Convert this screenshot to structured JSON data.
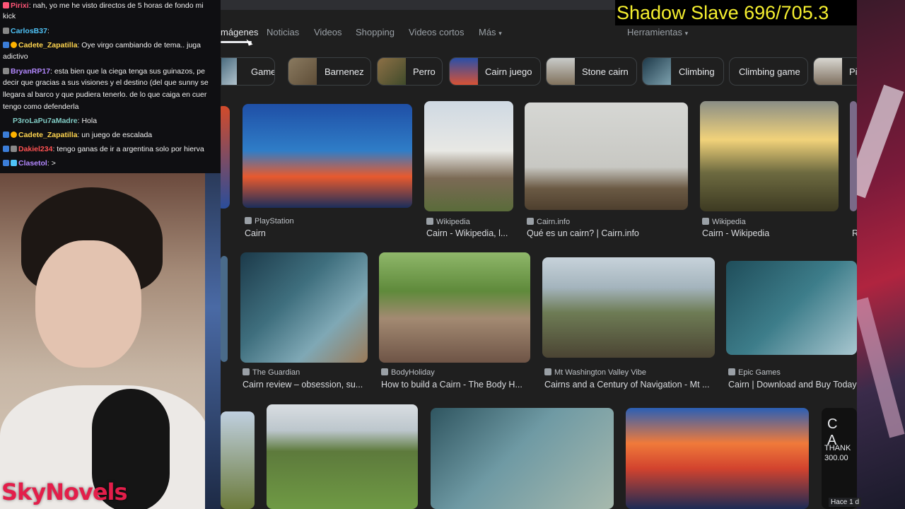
{
  "overlay": {
    "title": "Shadow Slave 696/705.3"
  },
  "tabs": [
    {
      "label": "mágenes",
      "active": true
    },
    {
      "label": "Noticias"
    },
    {
      "label": "Videos"
    },
    {
      "label": "Shopping"
    },
    {
      "label": "Videos cortos"
    },
    {
      "label": "Más"
    }
  ],
  "tools": {
    "label": "Herramientas"
  },
  "chips": [
    "Game",
    "Barnenez",
    "Perro",
    "Cairn juego",
    "Stone cairn",
    "Climbing",
    "Climbing game",
    "Pi"
  ],
  "results": {
    "row1": [
      {
        "source": "PlayStation",
        "title": "Cairn"
      },
      {
        "source": "Wikipedia",
        "title": "Cairn - Wikipedia, l..."
      },
      {
        "source": "Cairn.info",
        "title": "Qué es un cairn? | Cairn.info"
      },
      {
        "source": "Wikipedia",
        "title": "Cairn - Wikipedia"
      },
      {
        "source": "",
        "title": "R"
      }
    ],
    "row2": [
      {
        "source": "The Guardian",
        "title": "Cairn review – obsession, su..."
      },
      {
        "source": "BodyHoliday",
        "title": "How to build a Cairn - The Body H..."
      },
      {
        "source": "Mt Washington Valley Vibe",
        "title": "Cairns and a Century of Navigation - Mt ..."
      },
      {
        "source": "Epic Games",
        "title": "Cairn | Download and Buy Today"
      }
    ],
    "row3_partial_text": "C A",
    "row3_partial_small": "THANK\n300.00"
  },
  "bottom_badge": "Hace 1 d",
  "chat": [
    {
      "user": "Pirixi",
      "user_color": "#ff5577",
      "text": ": nah, yo me he visto directos de 5 horas de fondo mi"
    },
    {
      "user": "",
      "user_color": "#ffffff",
      "text": "kick"
    },
    {
      "user": "CarlosB37",
      "user_color": "#4fc3f7",
      "text": ": "
    },
    {
      "user": "Cadete_Zapatilla",
      "user_color": "#ffd54f",
      "text": ": Oye virgo cambiando de tema.. juga"
    },
    {
      "user": "",
      "user_color": "#ffffff",
      "text": "adictivo"
    },
    {
      "user": "BryanRP17",
      "user_color": "#b388ff",
      "text": ": esta bien que la ciega tenga sus guinazos, pe"
    },
    {
      "user": "",
      "user_color": "#ffffff",
      "text": "decir que gracias a sus visiones y el destino (del que sunny se"
    },
    {
      "user": "",
      "user_color": "#ffffff",
      "text": "llegara al barco y que pudiera tenerlo. de lo que caiga en cuer"
    },
    {
      "user": "",
      "user_color": "#ffffff",
      "text": "tengo como defenderla"
    },
    {
      "user": "P3roLaPu7aMadre",
      "user_color": "#80cbc4",
      "text": ": Hola"
    },
    {
      "user": "Cadete_Zapatilla",
      "user_color": "#ffd54f",
      "text": ": un juego de escalada"
    },
    {
      "user": "Dakiel234",
      "user_color": "#ff5252",
      "text": ": tengo ganas de ir a argentina solo por hierva"
    },
    {
      "user": "Clasetol",
      "user_color": "#b388ff",
      "text": ": >"
    }
  ],
  "branding": {
    "logo_text": "SkyNovels"
  }
}
